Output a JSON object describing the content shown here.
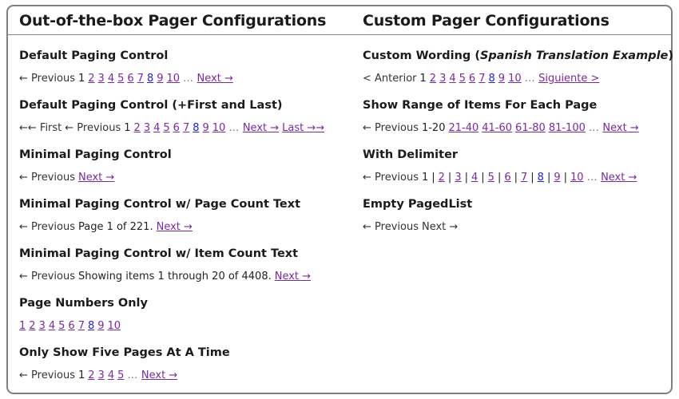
{
  "page": {
    "left_heading": "Out-of-the-box Pager Configurations",
    "right_heading": "Custom Pager Configurations"
  },
  "colors": {
    "link_visited": "#7a2a9e",
    "link_unvisited": "#2222dd",
    "border": "#808080",
    "rule": "#888888",
    "text": "#1b1b1b",
    "ellipsis": "#777777"
  },
  "left_column": {
    "sections": [
      {
        "title": "Default Paging Control",
        "name": "default-paging-control",
        "items": [
          {
            "text": "← Previous",
            "type": "disabled"
          },
          {
            "text": "1",
            "type": "current"
          },
          {
            "text": "2",
            "type": "link"
          },
          {
            "text": "3",
            "type": "link"
          },
          {
            "text": "4",
            "type": "link"
          },
          {
            "text": "5",
            "type": "link"
          },
          {
            "text": "6",
            "type": "link"
          },
          {
            "text": "7",
            "type": "link"
          },
          {
            "text": "8",
            "type": "link-unvisited"
          },
          {
            "text": "9",
            "type": "link"
          },
          {
            "text": "10",
            "type": "link"
          },
          {
            "text": "…",
            "type": "ellipsis"
          },
          {
            "text": "Next →",
            "type": "link"
          }
        ]
      },
      {
        "title": "Default Paging Control (+First and Last)",
        "name": "default-paging-control-first-last",
        "items": [
          {
            "text": "←← First",
            "type": "disabled"
          },
          {
            "text": "← Previous",
            "type": "disabled"
          },
          {
            "text": "1",
            "type": "current"
          },
          {
            "text": "2",
            "type": "link"
          },
          {
            "text": "3",
            "type": "link"
          },
          {
            "text": "4",
            "type": "link"
          },
          {
            "text": "5",
            "type": "link"
          },
          {
            "text": "6",
            "type": "link"
          },
          {
            "text": "7",
            "type": "link"
          },
          {
            "text": "8",
            "type": "link-unvisited"
          },
          {
            "text": "9",
            "type": "link"
          },
          {
            "text": "10",
            "type": "link"
          },
          {
            "text": "…",
            "type": "ellipsis"
          },
          {
            "text": "Next →",
            "type": "link"
          },
          {
            "text": "Last →→",
            "type": "link"
          }
        ]
      },
      {
        "title": "Minimal Paging Control",
        "name": "minimal-paging-control",
        "items": [
          {
            "text": "← Previous",
            "type": "disabled"
          },
          {
            "text": "Next →",
            "type": "link"
          }
        ]
      },
      {
        "title": "Minimal Paging Control w/ Page Count Text",
        "name": "minimal-paging-control-page-count",
        "items": [
          {
            "text": "← Previous",
            "type": "disabled"
          },
          {
            "text": "Page 1 of 221.",
            "type": "text"
          },
          {
            "text": "Next →",
            "type": "link"
          }
        ]
      },
      {
        "title": "Minimal Paging Control w/ Item Count Text",
        "name": "minimal-paging-control-item-count",
        "items": [
          {
            "text": "← Previous",
            "type": "disabled"
          },
          {
            "text": "Showing items 1 through 20 of 4408.",
            "type": "text"
          },
          {
            "text": "Next →",
            "type": "link"
          }
        ]
      },
      {
        "title": "Page Numbers Only",
        "name": "page-numbers-only",
        "items": [
          {
            "text": "1",
            "type": "link"
          },
          {
            "text": "2",
            "type": "link"
          },
          {
            "text": "3",
            "type": "link"
          },
          {
            "text": "4",
            "type": "link"
          },
          {
            "text": "5",
            "type": "link"
          },
          {
            "text": "6",
            "type": "link"
          },
          {
            "text": "7",
            "type": "link"
          },
          {
            "text": "8",
            "type": "link-unvisited"
          },
          {
            "text": "9",
            "type": "link"
          },
          {
            "text": "10",
            "type": "link"
          }
        ]
      },
      {
        "title": "Only Show Five Pages At A Time",
        "name": "only-show-five-pages",
        "items": [
          {
            "text": "← Previous",
            "type": "disabled"
          },
          {
            "text": "1",
            "type": "current"
          },
          {
            "text": "2",
            "type": "link"
          },
          {
            "text": "3",
            "type": "link"
          },
          {
            "text": "4",
            "type": "link"
          },
          {
            "text": "5",
            "type": "link"
          },
          {
            "text": "…",
            "type": "ellipsis"
          },
          {
            "text": "Next →",
            "type": "link"
          }
        ]
      }
    ]
  },
  "right_column": {
    "sections": [
      {
        "title_prefix": "Custom Wording (",
        "title_em": "Spanish Translation Example",
        "title_suffix": ")",
        "name": "custom-wording",
        "items": [
          {
            "text": "< Anterior",
            "type": "disabled"
          },
          {
            "text": "1",
            "type": "current"
          },
          {
            "text": "2",
            "type": "link"
          },
          {
            "text": "3",
            "type": "link"
          },
          {
            "text": "4",
            "type": "link"
          },
          {
            "text": "5",
            "type": "link"
          },
          {
            "text": "6",
            "type": "link"
          },
          {
            "text": "7",
            "type": "link"
          },
          {
            "text": "8",
            "type": "link-unvisited"
          },
          {
            "text": "9",
            "type": "link"
          },
          {
            "text": "10",
            "type": "link"
          },
          {
            "text": "…",
            "type": "ellipsis"
          },
          {
            "text": "Siguiente >",
            "type": "link"
          }
        ]
      },
      {
        "title": "Show Range of Items For Each Page",
        "name": "show-range-of-items",
        "items": [
          {
            "text": "← Previous",
            "type": "disabled"
          },
          {
            "text": "1-20",
            "type": "current"
          },
          {
            "text": "21-40",
            "type": "link"
          },
          {
            "text": "41-60",
            "type": "link"
          },
          {
            "text": "61-80",
            "type": "link"
          },
          {
            "text": "81-100",
            "type": "link"
          },
          {
            "text": "…",
            "type": "ellipsis"
          },
          {
            "text": "Next →",
            "type": "link"
          }
        ]
      },
      {
        "title": "With Delimiter",
        "name": "with-delimiter",
        "delimiter": "|",
        "items": [
          {
            "text": "← Previous",
            "type": "disabled"
          },
          {
            "text": "1",
            "type": "current",
            "delim_after": true
          },
          {
            "text": "2",
            "type": "link",
            "delim_after": true
          },
          {
            "text": "3",
            "type": "link",
            "delim_after": true
          },
          {
            "text": "4",
            "type": "link",
            "delim_after": true
          },
          {
            "text": "5",
            "type": "link",
            "delim_after": true
          },
          {
            "text": "6",
            "type": "link",
            "delim_after": true
          },
          {
            "text": "7",
            "type": "link",
            "delim_after": true
          },
          {
            "text": "8",
            "type": "link-unvisited",
            "delim_after": true
          },
          {
            "text": "9",
            "type": "link",
            "delim_after": true
          },
          {
            "text": "10",
            "type": "link"
          },
          {
            "text": "…",
            "type": "ellipsis"
          },
          {
            "text": "Next →",
            "type": "link"
          }
        ]
      },
      {
        "title": "Empty PagedList",
        "name": "empty-pagedlist",
        "items": [
          {
            "text": "← Previous",
            "type": "disabled"
          },
          {
            "text": "Next →",
            "type": "disabled"
          }
        ]
      }
    ]
  }
}
